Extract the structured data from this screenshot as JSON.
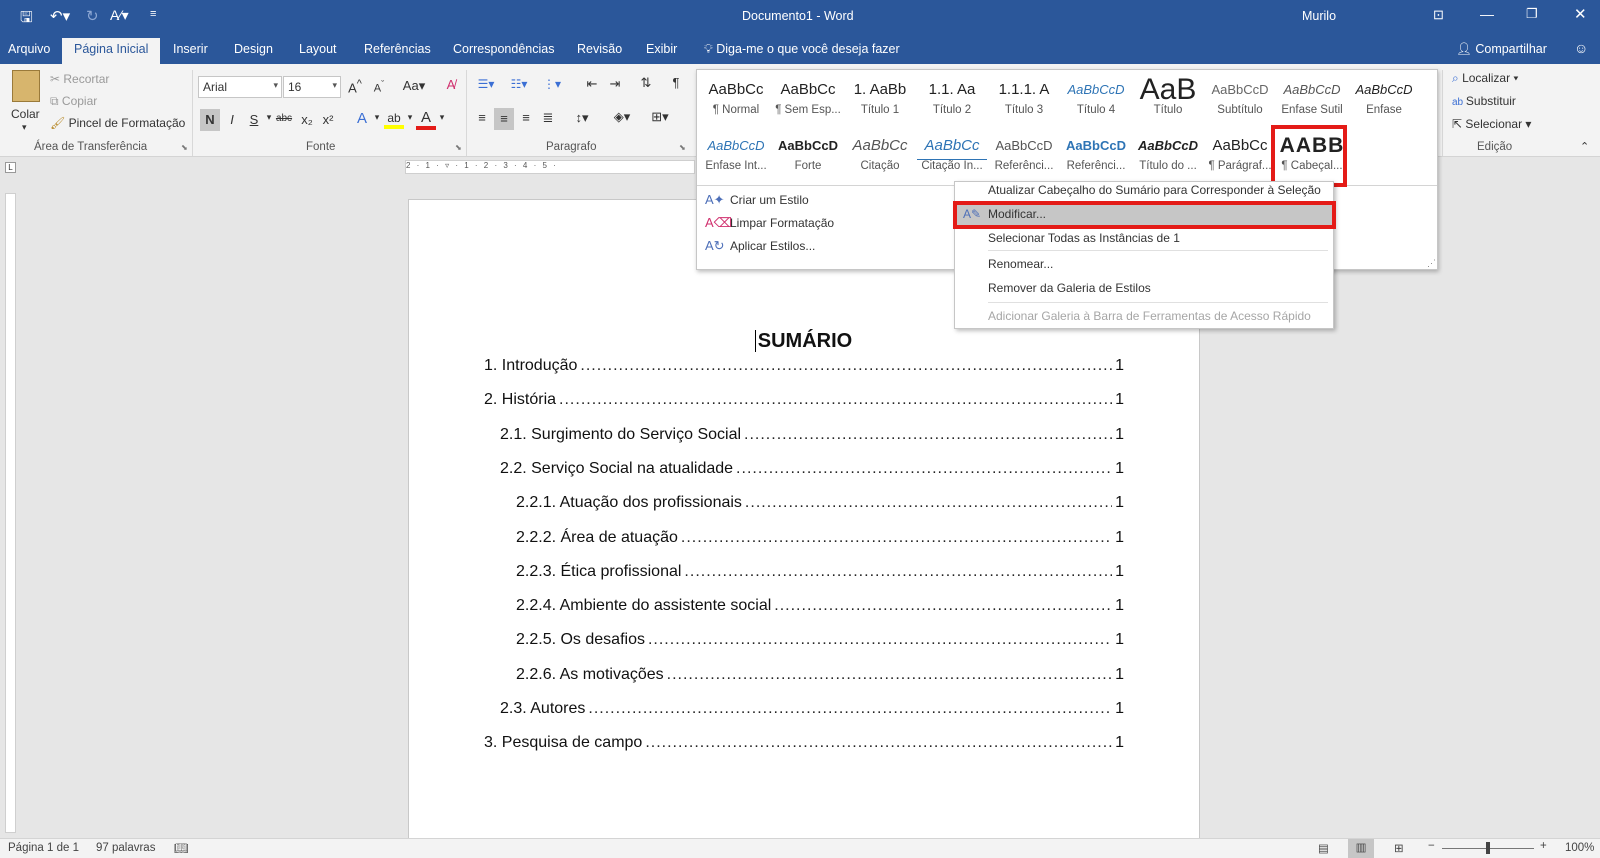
{
  "window": {
    "title": "Documento1 - Word",
    "user": "Murilo"
  },
  "quick_access": {
    "save_icon": "save-icon",
    "undo_icon": "undo-icon",
    "redo_icon": "redo-icon",
    "spelling_icon": "spelling-icon",
    "customize_icon": "customize-icon"
  },
  "tabs": [
    "Arquivo",
    "Página Inicial",
    "Inserir",
    "Design",
    "Layout",
    "Referências",
    "Correspondências",
    "Revisão",
    "Exibir"
  ],
  "tell_me": "Diga-me o que você deseja fazer",
  "share": "Compartilhar",
  "clipboard": {
    "paste": "Colar",
    "cut": "Recortar",
    "copy": "Copiar",
    "format_painter": "Pincel de Formatação",
    "label": "Área de Transferência"
  },
  "font": {
    "name": "Arial",
    "size": "16",
    "label": "Fonte",
    "grow": "A",
    "shrink": "A",
    "case": "Aa",
    "bold": "N",
    "italic": "I",
    "underline": "S",
    "strike": "abc",
    "sub": "x₂",
    "sup": "x²",
    "text_effects": "A",
    "highlight": "ab",
    "font_color": "A",
    "highlight_color": "#ffff00",
    "font_color_value": "#e41b17"
  },
  "paragraph": {
    "label": "Paragrafo"
  },
  "styles": [
    {
      "preview": "AaBbCc",
      "name": "¶ Normal"
    },
    {
      "preview": "AaBbCc",
      "name": "¶ Sem Esp..."
    },
    {
      "preview": "1. AaBb",
      "name": "Título 1"
    },
    {
      "preview": "1.1. Aa",
      "name": "Título 2"
    },
    {
      "preview": "1.1.1. A",
      "name": "Título 3"
    },
    {
      "preview": "AaBbCcD",
      "name": "Título 4"
    },
    {
      "preview": "AaB",
      "name": "Título"
    },
    {
      "preview": "AaBbCcD",
      "name": "Subtítulo"
    },
    {
      "preview": "AaBbCcD",
      "name": "Ênfase Sutil"
    },
    {
      "preview": "AaBbCcD",
      "name": "Ênfase"
    },
    {
      "preview": "AaBbCcD",
      "name": "Ênfase Int..."
    },
    {
      "preview": "AaBbCcD",
      "name": "Forte"
    },
    {
      "preview": "AaBbCc",
      "name": "Citação"
    },
    {
      "preview": "AaBbCc",
      "name": "Citação In..."
    },
    {
      "preview": "AaBbCcD",
      "name": "Referênci..."
    },
    {
      "preview": "AaBbCcD",
      "name": "Referênci..."
    },
    {
      "preview": "AaBbCcD",
      "name": "Título do ..."
    },
    {
      "preview": "AaBbCc",
      "name": "¶ Parágraf..."
    },
    {
      "preview": "AABB",
      "name": "¶ Cabeçal..."
    }
  ],
  "style_menu": {
    "create": "Criar um Estilo",
    "clear": "Limpar Formatação",
    "apply": "Aplicar Estilos..."
  },
  "context_menu": {
    "update": "Atualizar Cabeçalho do Sumário para Corresponder à Seleção",
    "modify": "Modificar...",
    "select_all": "Selecionar Todas as Instâncias de 1",
    "rename": "Renomear...",
    "remove": "Remover da Galeria de Estilos",
    "add_qat": "Adicionar Galeria à Barra de Ferramentas de Acesso Rápido"
  },
  "editing": {
    "find": "Localizar",
    "replace": "Substituir",
    "select": "Selecionar",
    "label": "Edição"
  },
  "ruler": {
    "marks": "2 · 1 · ▿ · 1 · 2 · 3 · 4 · 5 ·"
  },
  "document": {
    "heading": "SUMÁRIO",
    "toc": [
      {
        "text": "1. Introdução",
        "page": "1"
      },
      {
        "text": "2. História",
        "page": "1"
      },
      {
        "text": "2.1. Surgimento do Serviço Social",
        "page": "1"
      },
      {
        "text": "2.2. Serviço Social na atualidade",
        "page": "1"
      },
      {
        "text": "2.2.1. Atuação dos profissionais",
        "page": "1"
      },
      {
        "text": "2.2.2. Área de atuação",
        "page": "1"
      },
      {
        "text": "2.2.3. Ética profissional",
        "page": "1"
      },
      {
        "text": "2.2.4. Ambiente do assistente social",
        "page": "1"
      },
      {
        "text": "2.2.5. Os desafios",
        "page": "1"
      },
      {
        "text": "2.2.6. As motivações",
        "page": "1"
      },
      {
        "text": "2.3. Autores",
        "page": "1"
      },
      {
        "text": "3. Pesquisa de campo",
        "page": "1"
      }
    ]
  },
  "status": {
    "page": "Página 1 de 1",
    "words": "97 palavras",
    "zoom": "100%",
    "zoom_level": 1.0
  },
  "colors": {
    "brand": "#2b579a",
    "highlight_box": "#e41b17",
    "selected_menu": "#c6c6c6"
  }
}
